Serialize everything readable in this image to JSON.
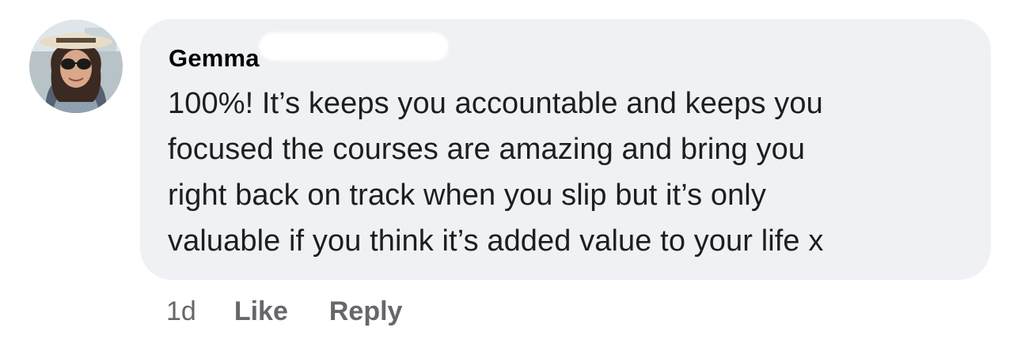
{
  "comment": {
    "author": "Gemma",
    "text_lines": [
      "100%! It’s keeps you accountable and keeps you",
      "focused the courses are amazing and bring you",
      "right back on track when you slip but it’s only",
      "valuable if you think it’s added value to your life x"
    ],
    "timestamp": "1d",
    "actions": {
      "like_label": "Like",
      "reply_label": "Reply"
    }
  },
  "icons": {
    "avatar": "profile-photo"
  },
  "colors": {
    "bubble_background": "#eff1f5",
    "text": "#1c1e21",
    "meta_text": "#65676b"
  }
}
